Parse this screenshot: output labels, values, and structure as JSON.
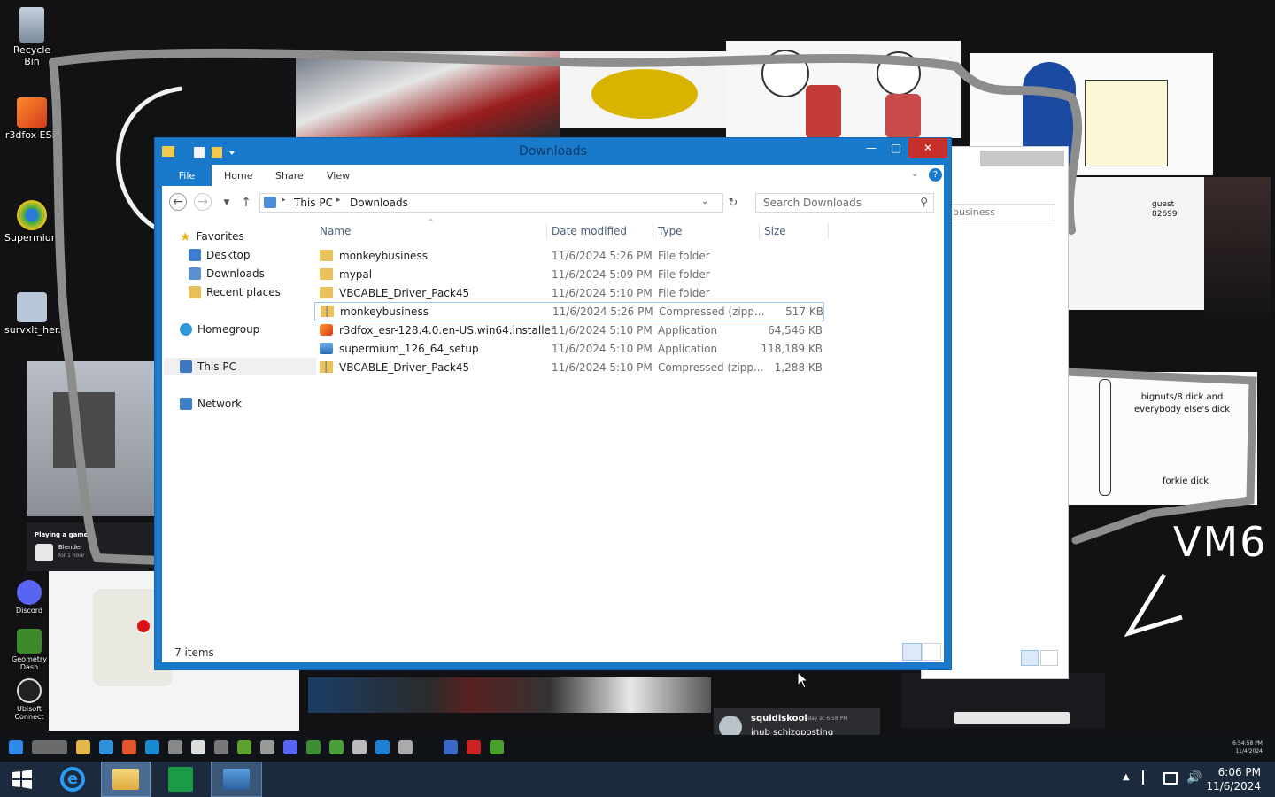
{
  "desktop": {
    "icons": [
      {
        "label": "Recycle Bin",
        "icon": "recycle-bin-icon"
      },
      {
        "label": "r3dfox ESR",
        "icon": "firefox-icon"
      },
      {
        "label": "Supermium",
        "icon": "chrome-icon"
      },
      {
        "label": "survxlt_her...",
        "icon": "app-icon"
      },
      {
        "label": "Discord",
        "icon": "discord-icon"
      },
      {
        "label": "Geometry Dash",
        "icon": "geometry-dash-icon"
      },
      {
        "label": "Ubisoft Connect",
        "icon": "ubisoft-icon"
      }
    ],
    "annotations": {
      "vm_label": "VM6",
      "bignuts_note": "bignuts/8 dick and everybody else's dick",
      "forkie_note": "forkie dick",
      "guest_label": "guest",
      "guest_number": "82699"
    },
    "toast": {
      "name": "squidiskool",
      "time": "Today at 6:58 PM",
      "message": "inub schizoposting"
    },
    "playing": {
      "heading": "Playing a game",
      "game": "Blender",
      "duration": "for 1 hour"
    },
    "inner_clock": {
      "time": "6:54:58 PM",
      "date": "11/4/2024"
    }
  },
  "explorer": {
    "title": "Downloads",
    "ribbon_tabs": [
      "File",
      "Home",
      "Share",
      "View"
    ],
    "breadcrumb": [
      "This PC",
      "Downloads"
    ],
    "search_placeholder": "Search Downloads",
    "nav": {
      "favorites": "Favorites",
      "favorite_items": [
        "Desktop",
        "Downloads",
        "Recent places"
      ],
      "homegroup": "Homegroup",
      "this_pc": "This PC",
      "network": "Network"
    },
    "columns": {
      "name": "Name",
      "date": "Date modified",
      "type": "Type",
      "size": "Size"
    },
    "files": [
      {
        "name": "monkeybusiness",
        "date": "11/6/2024 5:26 PM",
        "type": "File folder",
        "size": "",
        "icon": "folder-icon"
      },
      {
        "name": "mypal",
        "date": "11/6/2024 5:09 PM",
        "type": "File folder",
        "size": "",
        "icon": "folder-icon"
      },
      {
        "name": "VBCABLE_Driver_Pack45",
        "date": "11/6/2024 5:10 PM",
        "type": "File folder",
        "size": "",
        "icon": "folder-icon"
      },
      {
        "name": "monkeybusiness",
        "date": "11/6/2024 5:26 PM",
        "type": "Compressed (zipp...",
        "size": "517 KB",
        "icon": "zip-folder-icon"
      },
      {
        "name": "r3dfox_esr-128.4.0.en-US.win64.installer",
        "date": "11/6/2024 5:10 PM",
        "type": "Application",
        "size": "64,546 KB",
        "icon": "installer-icon"
      },
      {
        "name": "supermium_126_64_setup",
        "date": "11/6/2024 5:10 PM",
        "type": "Application",
        "size": "118,189 KB",
        "icon": "setup-icon"
      },
      {
        "name": "VBCABLE_Driver_Pack45",
        "date": "11/6/2024 5:10 PM",
        "type": "Compressed (zipp...",
        "size": "1,288 KB",
        "icon": "zip-folder-icon"
      }
    ],
    "status": "7 items"
  },
  "background_window": {
    "search_text": "business"
  },
  "taskbar": {
    "time": "6:06 PM",
    "date": "11/6/2024"
  },
  "colors": {
    "accent": "#1979ca",
    "taskbar": "#1c2a3e",
    "title_text": "#0b3b66"
  }
}
